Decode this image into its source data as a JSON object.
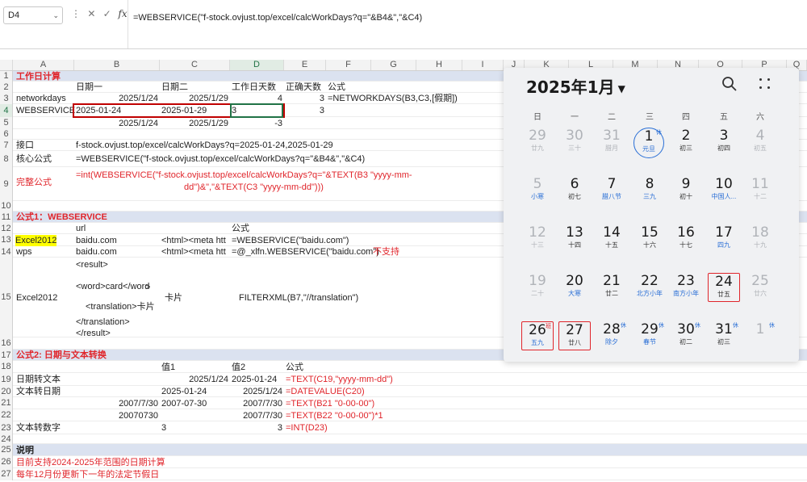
{
  "formula_bar": {
    "name_box": "D4",
    "cancel_glyph": "✕",
    "confirm_glyph": "✓",
    "fx_label": "fx",
    "formula": "=WEBSERVICE(\"f-stock.ovjust.top/excel/calcWorkDays?q=\"&B4&\",\"&C4)"
  },
  "columns": [
    "A",
    "B",
    "C",
    "D",
    "E",
    "F",
    "G",
    "H",
    "I",
    "J",
    "K",
    "L",
    "M",
    "N",
    "O",
    "P",
    "Q"
  ],
  "selected_column": "D",
  "selected_row": "4",
  "rows": {
    "r1": {
      "num": "1",
      "a": "工作日计算"
    },
    "r2": {
      "num": "2",
      "b": "日期一",
      "c": "日期二",
      "d": "工作日天数",
      "e": "正确天数",
      "f": "公式"
    },
    "r3": {
      "num": "3",
      "a": "networkdays",
      "b": "2025/1/24",
      "c": "2025/1/29",
      "d": "4",
      "e": "3",
      "f": "=NETWORKDAYS(B3,C3,[假期])"
    },
    "r4": {
      "num": "4",
      "a": "WEBSERVICE",
      "b": "2025-01-24",
      "c": "2025-01-29",
      "d": "3",
      "e": "3"
    },
    "r5": {
      "num": "5",
      "b": "2025/1/24",
      "c": "2025/1/29",
      "d": "-3"
    },
    "r6": {
      "num": "6"
    },
    "r7": {
      "num": "7",
      "a": "接口",
      "b": "f-stock.ovjust.top/excel/calcWorkDays?q=2025-01-24,2025-01-29"
    },
    "r8": {
      "num": "8",
      "a": "核心公式",
      "b": "=WEBSERVICE(\"f-stock.ovjust.top/excel/calcWorkDays?q=\"&B4&\",\"&C4)"
    },
    "r9": {
      "num": "9",
      "a": "完整公式",
      "b1": "=int(WEBSERVICE(\"f-stock.ovjust.top/excel/calcWorkDays?q=\"&TEXT(B3 \"yyyy-mm-",
      "b2": "dd\")&\",\"&TEXT(C3 \"yyyy-mm-dd\")))"
    },
    "r10": {
      "num": "10"
    },
    "r11": {
      "num": "11",
      "a": "公式1：WEBSERVICE"
    },
    "r12": {
      "num": "12",
      "b": "url",
      "d": "公式"
    },
    "r13": {
      "num": "13",
      "a": "Excel2012",
      "b": "baidu.com",
      "c": "<html><meta htt",
      "d": "=WEBSERVICE(\"baidu.com\")"
    },
    "r14": {
      "num": "14",
      "a": "wps",
      "b": "baidu.com",
      "c": "<html><meta htt",
      "d": "=@_xlfn.WEBSERVICE(\"baidu.com\")",
      "note": "不支持"
    },
    "r15": {
      "num": "15",
      "a": "Excel2012",
      "xml": [
        "<result>",
        "",
        "<word>card</word",
        ">",
        "<translation>卡片",
        "</translation>",
        "</result>"
      ],
      "c": "卡片",
      "d": "FILTERXML(B7,\"//translation\")"
    },
    "r16": {
      "num": "16"
    },
    "r17": {
      "num": "17",
      "a": "公式2: 日期与文本转换"
    },
    "r18": {
      "num": "18",
      "c": "值1",
      "d": "值2",
      "e": "公式"
    },
    "r19": {
      "num": "19",
      "a": "日期转文本",
      "c": "2025/1/24",
      "d": "2025-01-24",
      "e": "=TEXT(C19,\"yyyy-mm-dd\")"
    },
    "r20": {
      "num": "20",
      "a": "文本转日期",
      "c": "2025-01-24",
      "d": "2025/1/24",
      "e": "=DATEVALUE(C20)"
    },
    "r21": {
      "num": "21",
      "b": "2007/7/30",
      "c": "2007-07-30",
      "d": "2007/7/30",
      "e": "=TEXT(B21 \"0-00-00\")"
    },
    "r22": {
      "num": "22",
      "b": "20070730",
      "d": "2007/7/30",
      "e": "=TEXT(B22 \"0-00-00\")*1"
    },
    "r23": {
      "num": "23",
      "a": "文本转数字",
      "c": "3",
      "d": "3",
      "e": "=INT(D23)"
    },
    "r24": {
      "num": "24"
    },
    "r25": {
      "num": "25",
      "a": "说明"
    },
    "r26": {
      "num": "26",
      "a": "目前支持2024-2025年范围的日期计算"
    },
    "r27": {
      "num": "27",
      "a": "每年12月份更新下一年的法定节假日"
    }
  },
  "calendar": {
    "title": "2025年1月",
    "caret": "▼",
    "weekdays": [
      "日",
      "一",
      "二",
      "三",
      "四",
      "五",
      "六"
    ],
    "weeks": [
      [
        {
          "d": "29",
          "l": "廿九",
          "m": true
        },
        {
          "d": "30",
          "l": "三十",
          "m": true
        },
        {
          "d": "31",
          "l": "腊月",
          "m": true
        },
        {
          "d": "1",
          "l": "元旦",
          "s": "today",
          "t": "休",
          "lc": "blue"
        },
        {
          "d": "2",
          "l": "初三"
        },
        {
          "d": "3",
          "l": "初四"
        },
        {
          "d": "4",
          "l": "初五",
          "m": true
        }
      ],
      [
        {
          "d": "5",
          "l": "小寒",
          "m": true,
          "lc": "blue"
        },
        {
          "d": "6",
          "l": "初七"
        },
        {
          "d": "7",
          "l": "腊八节",
          "lc": "blue"
        },
        {
          "d": "8",
          "l": "三九",
          "lc": "blue"
        },
        {
          "d": "9",
          "l": "初十"
        },
        {
          "d": "10",
          "l": "中国人...",
          "lc": "blue"
        },
        {
          "d": "11",
          "l": "十二",
          "m": true
        }
      ],
      [
        {
          "d": "12",
          "l": "十三",
          "m": true
        },
        {
          "d": "13",
          "l": "十四"
        },
        {
          "d": "14",
          "l": "十五"
        },
        {
          "d": "15",
          "l": "十六"
        },
        {
          "d": "16",
          "l": "十七"
        },
        {
          "d": "17",
          "l": "四九",
          "lc": "blue"
        },
        {
          "d": "18",
          "l": "十九",
          "m": true
        }
      ],
      [
        {
          "d": "19",
          "l": "二十",
          "m": true
        },
        {
          "d": "20",
          "l": "大寒",
          "lc": "blue"
        },
        {
          "d": "21",
          "l": "廿二"
        },
        {
          "d": "22",
          "l": "北方小年",
          "lc": "blue"
        },
        {
          "d": "23",
          "l": "南方小年",
          "lc": "blue"
        },
        {
          "d": "24",
          "l": "廿五",
          "s": "boxed"
        },
        {
          "d": "25",
          "l": "廿六",
          "m": true
        }
      ],
      [
        {
          "d": "26",
          "l": "五九",
          "s": "boxed",
          "t": "班",
          "tc": "red",
          "lc": "blue"
        },
        {
          "d": "27",
          "l": "廿八",
          "s": "boxed"
        },
        {
          "d": "28",
          "l": "除夕",
          "t": "休",
          "lc": "blue"
        },
        {
          "d": "29",
          "l": "春节",
          "t": "休",
          "lc": "blue"
        },
        {
          "d": "30",
          "l": "初二",
          "t": "休"
        },
        {
          "d": "31",
          "l": "初三",
          "t": "休"
        },
        {
          "d": "1",
          "l": "",
          "m": true,
          "t": "休"
        }
      ]
    ]
  },
  "icons": {
    "search": "search-icon",
    "more": "more-dots-icon"
  }
}
